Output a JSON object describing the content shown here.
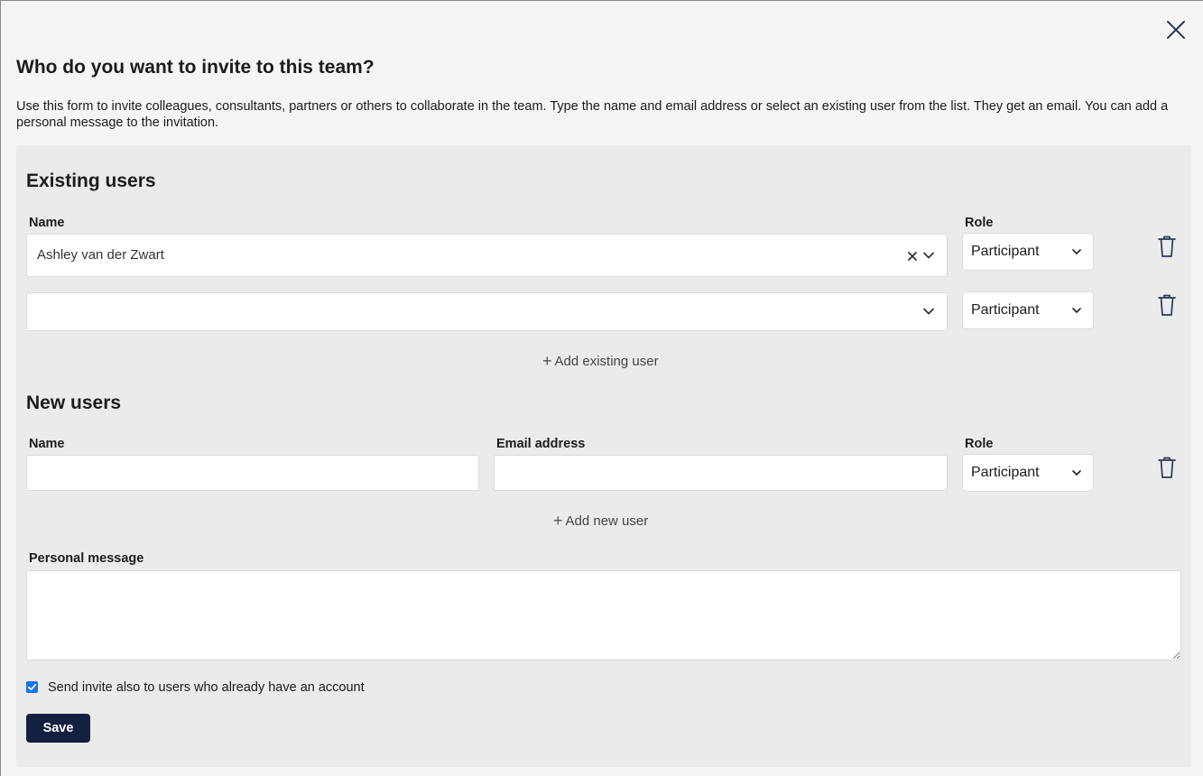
{
  "dialog": {
    "title": "Who do you want to invite to this team?",
    "intro": "Use this form to invite colleagues, consultants, partners or others to collaborate in the team. Type the name and email address or select an existing user from the list. They get an email. You can add a personal message to the invitation."
  },
  "icons": {
    "close": "close-icon",
    "clear": "clear-icon",
    "chevron": "chevron-down-icon",
    "trash": "trash-icon",
    "plus": "plus-icon"
  },
  "existing_users": {
    "title": "Existing users",
    "name_label": "Name",
    "role_label": "Role",
    "rows": [
      {
        "name": "Ashley van der Zwart",
        "role": "Participant"
      },
      {
        "name": "",
        "role": "Participant"
      }
    ],
    "add_label": "Add existing user"
  },
  "new_users": {
    "title": "New users",
    "name_label": "Name",
    "email_label": "Email address",
    "role_label": "Role",
    "rows": [
      {
        "name": "",
        "email": "",
        "role": "Participant"
      }
    ],
    "add_label": "Add new user"
  },
  "message": {
    "label": "Personal message",
    "value": ""
  },
  "send_invite": {
    "label": "Send invite also to users who already have an account",
    "checked": true
  },
  "actions": {
    "save_label": "Save"
  },
  "colors": {
    "primary_button": "#13203f",
    "checkbox": "#1a73e8",
    "panel_bg": "#ebebeb",
    "page_bg": "#f5f5f5"
  }
}
